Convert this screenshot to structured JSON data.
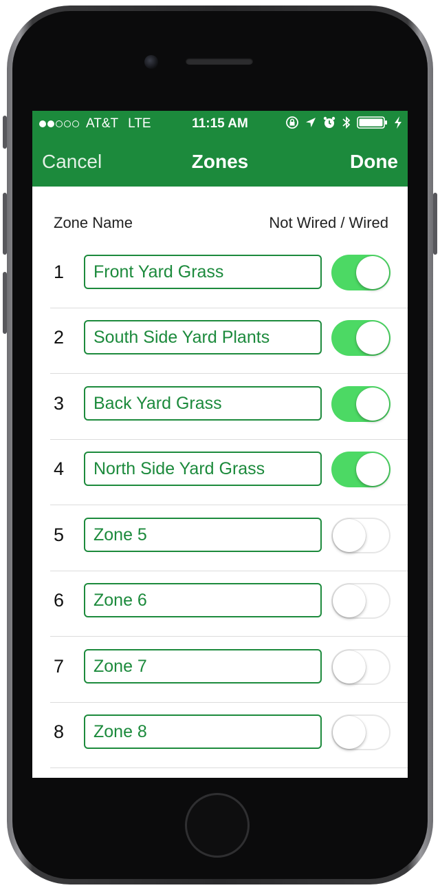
{
  "status_bar": {
    "signal_bars_full": 2,
    "signal_bars_total": 5,
    "carrier": "AT&T",
    "network": "LTE",
    "time": "11:15 AM",
    "icons": [
      "orientation-lock-icon",
      "location-arrow-icon",
      "alarm-icon",
      "bluetooth-icon",
      "battery-icon",
      "charging-bolt-icon"
    ]
  },
  "nav": {
    "cancel_label": "Cancel",
    "title": "Zones",
    "done_label": "Done"
  },
  "columns": {
    "name_header": "Zone Name",
    "wired_header": "Not Wired / Wired"
  },
  "zones": [
    {
      "number": "1",
      "name": "Front Yard Grass",
      "wired": true
    },
    {
      "number": "2",
      "name": "South Side Yard Plants",
      "wired": true
    },
    {
      "number": "3",
      "name": "Back Yard Grass",
      "wired": true
    },
    {
      "number": "4",
      "name": "North Side Yard Grass",
      "wired": true
    },
    {
      "number": "5",
      "name": "Zone 5",
      "wired": false
    },
    {
      "number": "6",
      "name": "Zone 6",
      "wired": false
    },
    {
      "number": "7",
      "name": "Zone 7",
      "wired": false
    },
    {
      "number": "8",
      "name": "Zone 8",
      "wired": false
    }
  ],
  "colors": {
    "brand_green": "#1c8a3c",
    "toggle_on": "#4cd964",
    "toggle_off_border": "#e6e6e6"
  }
}
